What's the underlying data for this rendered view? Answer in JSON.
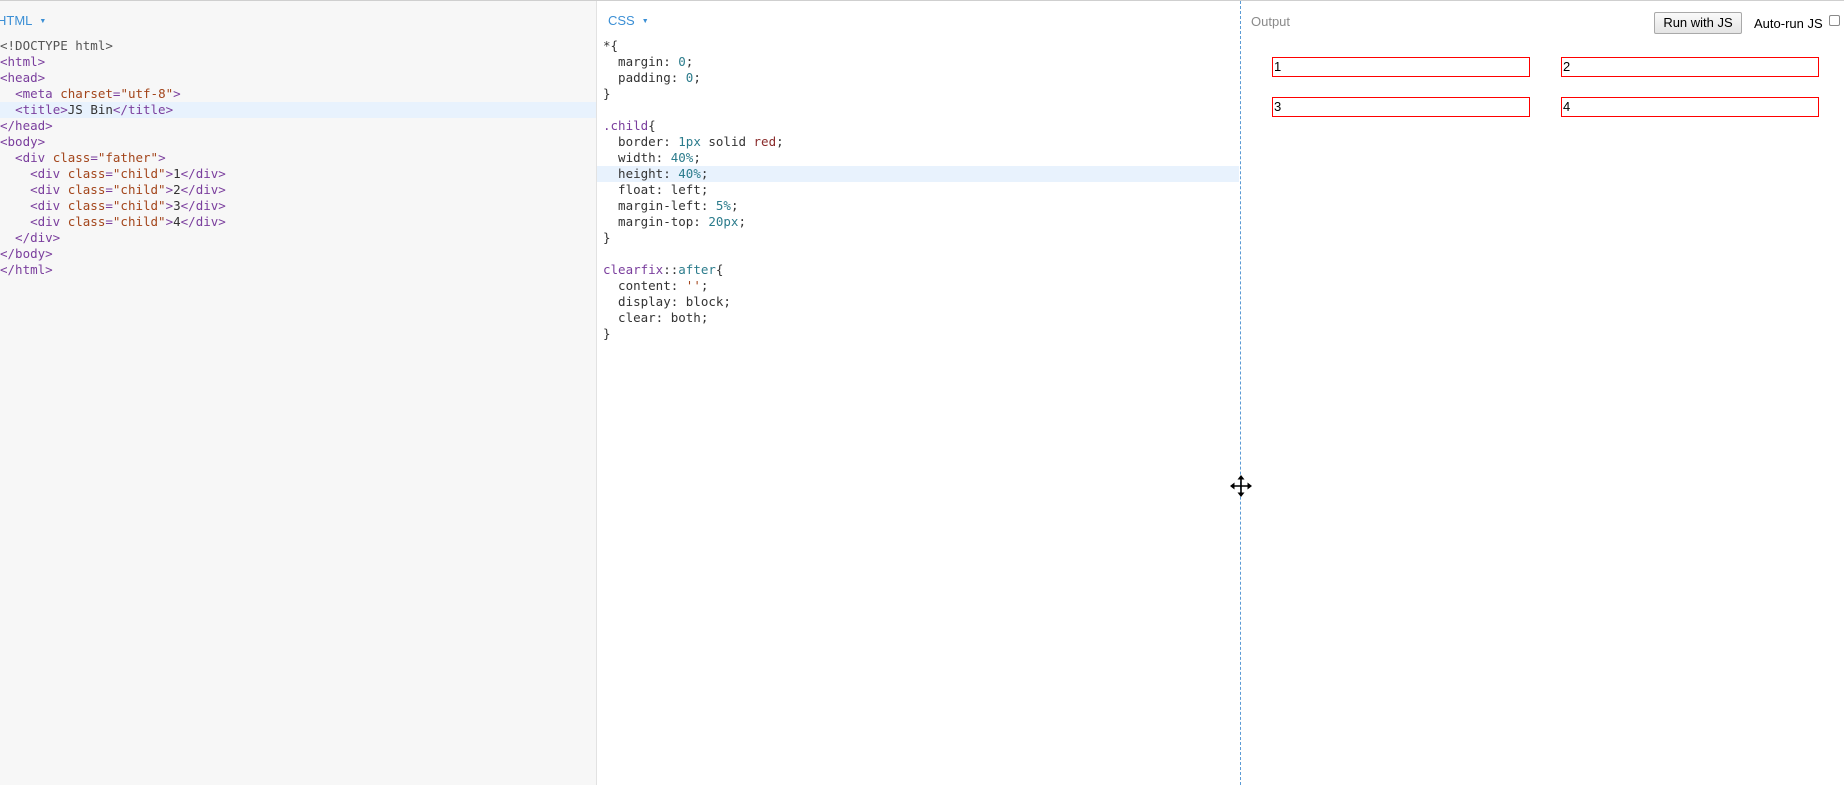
{
  "html_panel": {
    "label": "HTML",
    "lines": [
      [
        {
          "c": "tk-doctype",
          "t": "<!DOCTYPE html>"
        }
      ],
      [
        {
          "c": "tk-tag",
          "t": "<html>"
        }
      ],
      [
        {
          "c": "tk-tag",
          "t": "<head>"
        }
      ],
      [
        {
          "c": "tk-text",
          "t": "  "
        },
        {
          "c": "tk-tag",
          "t": "<meta "
        },
        {
          "c": "tk-attr",
          "t": "charset"
        },
        {
          "c": "tk-tag",
          "t": "="
        },
        {
          "c": "tk-str",
          "t": "\"utf-8\""
        },
        {
          "c": "tk-tag",
          "t": ">"
        }
      ],
      [
        {
          "c": "tk-text",
          "t": "  "
        },
        {
          "c": "tk-tag",
          "t": "<title>"
        },
        {
          "c": "tk-text",
          "t": "JS Bin"
        },
        {
          "c": "tk-tag",
          "t": "</title>"
        }
      ],
      [
        {
          "c": "tk-tag",
          "t": "</head>"
        }
      ],
      [
        {
          "c": "tk-tag",
          "t": "<body>"
        }
      ],
      [
        {
          "c": "tk-tag",
          "t": "  <div "
        },
        {
          "c": "tk-attr",
          "t": "class"
        },
        {
          "c": "tk-tag",
          "t": "="
        },
        {
          "c": "tk-str",
          "t": "\"father\""
        },
        {
          "c": "tk-tag",
          "t": ">"
        }
      ],
      [
        {
          "c": "tk-tag",
          "t": "    <div "
        },
        {
          "c": "tk-attr",
          "t": "class"
        },
        {
          "c": "tk-tag",
          "t": "="
        },
        {
          "c": "tk-str",
          "t": "\"child\""
        },
        {
          "c": "tk-tag",
          "t": ">"
        },
        {
          "c": "tk-text",
          "t": "1"
        },
        {
          "c": "tk-tag",
          "t": "</div>"
        }
      ],
      [
        {
          "c": "tk-tag",
          "t": "    <div "
        },
        {
          "c": "tk-attr",
          "t": "class"
        },
        {
          "c": "tk-tag",
          "t": "="
        },
        {
          "c": "tk-str",
          "t": "\"child\""
        },
        {
          "c": "tk-tag",
          "t": ">"
        },
        {
          "c": "tk-text",
          "t": "2"
        },
        {
          "c": "tk-tag",
          "t": "</div>"
        }
      ],
      [
        {
          "c": "tk-tag",
          "t": "    <div "
        },
        {
          "c": "tk-attr",
          "t": "class"
        },
        {
          "c": "tk-tag",
          "t": "="
        },
        {
          "c": "tk-str",
          "t": "\"child\""
        },
        {
          "c": "tk-tag",
          "t": ">"
        },
        {
          "c": "tk-text",
          "t": "3"
        },
        {
          "c": "tk-tag",
          "t": "</div>"
        }
      ],
      [
        {
          "c": "tk-tag",
          "t": "    <div "
        },
        {
          "c": "tk-attr",
          "t": "class"
        },
        {
          "c": "tk-tag",
          "t": "="
        },
        {
          "c": "tk-str",
          "t": "\"child\""
        },
        {
          "c": "tk-tag",
          "t": ">"
        },
        {
          "c": "tk-text",
          "t": "4"
        },
        {
          "c": "tk-tag",
          "t": "</div>"
        }
      ],
      [
        {
          "c": "tk-tag",
          "t": "  </div>"
        }
      ],
      [
        {
          "c": "tk-tag",
          "t": "</body>"
        }
      ],
      [
        {
          "c": "tk-tag",
          "t": "</html>"
        }
      ]
    ],
    "active_line": 4
  },
  "css_panel": {
    "label": "CSS",
    "lines": [
      [
        {
          "c": "tk-punc",
          "t": "*{"
        }
      ],
      [
        {
          "c": "tk-prop",
          "t": "  margin: "
        },
        {
          "c": "tk-num",
          "t": "0"
        },
        {
          "c": "tk-punc",
          "t": ";"
        }
      ],
      [
        {
          "c": "tk-prop",
          "t": "  padding: "
        },
        {
          "c": "tk-num",
          "t": "0"
        },
        {
          "c": "tk-punc",
          "t": ";"
        }
      ],
      [
        {
          "c": "tk-punc",
          "t": "}"
        }
      ],
      [
        {
          "c": "tk-punc",
          "t": ""
        }
      ],
      [
        {
          "c": "tk-sel",
          "t": ".child"
        },
        {
          "c": "tk-punc",
          "t": "{"
        }
      ],
      [
        {
          "c": "tk-prop",
          "t": "  border: "
        },
        {
          "c": "tk-num",
          "t": "1px"
        },
        {
          "c": "tk-prop",
          "t": " solid "
        },
        {
          "c": "tk-red",
          "t": "red"
        },
        {
          "c": "tk-punc",
          "t": ";"
        }
      ],
      [
        {
          "c": "tk-prop",
          "t": "  width: "
        },
        {
          "c": "tk-num",
          "t": "40%"
        },
        {
          "c": "tk-punc",
          "t": ";"
        }
      ],
      [
        {
          "c": "tk-prop",
          "t": "  height: "
        },
        {
          "c": "tk-num",
          "t": "40%"
        },
        {
          "c": "tk-punc",
          "t": ";"
        }
      ],
      [
        {
          "c": "tk-prop",
          "t": "  float: left;"
        }
      ],
      [
        {
          "c": "tk-prop",
          "t": "  margin-left: "
        },
        {
          "c": "tk-num",
          "t": "5%"
        },
        {
          "c": "tk-punc",
          "t": ";"
        }
      ],
      [
        {
          "c": "tk-prop",
          "t": "  margin-top: "
        },
        {
          "c": "tk-num",
          "t": "20px"
        },
        {
          "c": "tk-punc",
          "t": ";"
        }
      ],
      [
        {
          "c": "tk-punc",
          "t": "}"
        }
      ],
      [
        {
          "c": "tk-punc",
          "t": ""
        }
      ],
      [
        {
          "c": "tk-sel",
          "t": "clearfix"
        },
        {
          "c": "tk-punc",
          "t": "::"
        },
        {
          "c": "tk-pseudo",
          "t": "after"
        },
        {
          "c": "tk-punc",
          "t": "{"
        }
      ],
      [
        {
          "c": "tk-prop",
          "t": "  content: "
        },
        {
          "c": "tk-str2",
          "t": "''"
        },
        {
          "c": "tk-punc",
          "t": ";"
        }
      ],
      [
        {
          "c": "tk-prop",
          "t": "  display: block;"
        }
      ],
      [
        {
          "c": "tk-prop",
          "t": "  clear: both;"
        }
      ],
      [
        {
          "c": "tk-punc",
          "t": "}"
        }
      ]
    ],
    "active_line": 8
  },
  "output_panel": {
    "label": "Output",
    "run_button": "Run with JS",
    "autorun_label": "Auto-run JS",
    "autorun_checked": false,
    "children": [
      "1",
      "2",
      "3",
      "4"
    ],
    "child_border_color": "#ff0000"
  },
  "cursor": {
    "icon": "move-cursor-icon"
  }
}
